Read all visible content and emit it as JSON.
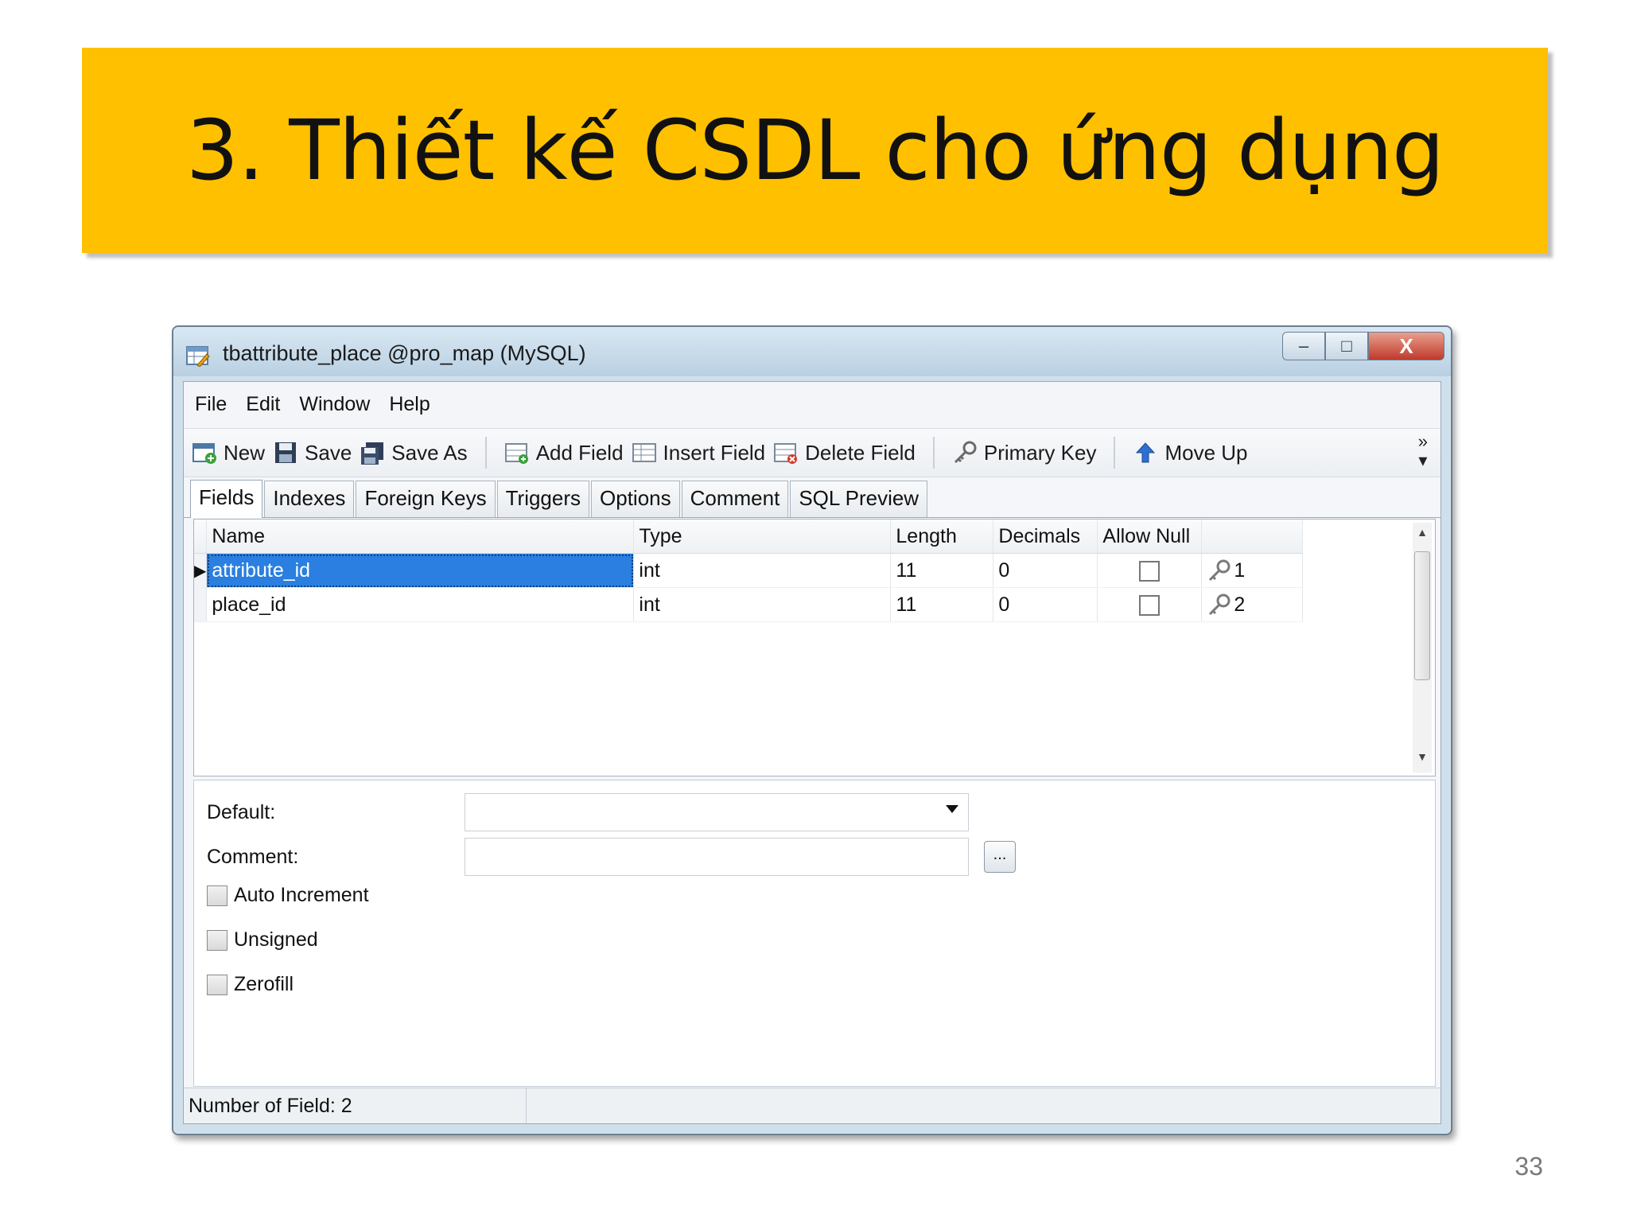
{
  "slide": {
    "title": "3. Thiết kế CSDL cho ứng dụng",
    "page_number": "33",
    "banner_color": "#FFC000"
  },
  "window": {
    "title": "tbattribute_place @pro_map (MySQL)",
    "controls": {
      "minimize": "–",
      "maximize": "□",
      "close": "X"
    }
  },
  "menu": [
    "File",
    "Edit",
    "Window",
    "Help"
  ],
  "toolbar": {
    "new": "New",
    "save": "Save",
    "save_as": "Save As",
    "add_field": "Add Field",
    "insert_field": "Insert Field",
    "delete_field": "Delete Field",
    "primary_key": "Primary Key",
    "move_up": "Move Up",
    "more": "»"
  },
  "tabs": [
    "Fields",
    "Indexes",
    "Foreign Keys",
    "Triggers",
    "Options",
    "Comment",
    "SQL Preview"
  ],
  "active_tab": "Fields",
  "grid": {
    "columns": [
      "Name",
      "Type",
      "Length",
      "Decimals",
      "Allow Null",
      ""
    ],
    "rows": [
      {
        "name": "attribute_id",
        "type": "int",
        "length": "11",
        "decimals": "0",
        "allow_null": false,
        "key": "1",
        "selected": true
      },
      {
        "name": "place_id",
        "type": "int",
        "length": "11",
        "decimals": "0",
        "allow_null": false,
        "key": "2",
        "selected": false
      }
    ]
  },
  "properties": {
    "default_label": "Default:",
    "default_value": "",
    "comment_label": "Comment:",
    "comment_value": "",
    "ellipsis": "...",
    "auto_increment": "Auto Increment",
    "unsigned": "Unsigned",
    "zerofill": "Zerofill"
  },
  "status": {
    "text": "Number of Field: 2"
  },
  "icons": {
    "new": "new-table-icon",
    "save": "floppy-disk-icon",
    "save_as": "save-as-icon",
    "add_field": "add-field-icon",
    "insert_field": "insert-field-icon",
    "delete_field": "delete-field-icon",
    "primary_key": "key-icon",
    "move_up": "arrow-up-icon"
  }
}
